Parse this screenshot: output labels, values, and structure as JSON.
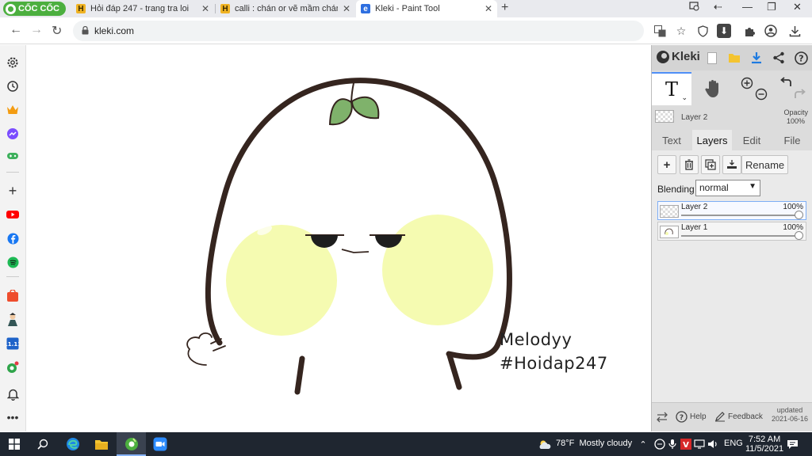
{
  "browser": {
    "brand": "CỐC CỐC",
    "tabs": [
      {
        "title": "Hỏi đáp 247 - trang tra loi",
        "active": false
      },
      {
        "title": "calli : chán or vẽ mầm chán N",
        "active": false
      },
      {
        "title": "Kleki - Paint Tool",
        "active": true
      }
    ],
    "url": "kleki.com"
  },
  "canvas": {
    "signature_line1": "Melodyy",
    "signature_line2": "#Hoidap247"
  },
  "kleki": {
    "app_name": "Kleki",
    "current_layer": {
      "name": "Layer 2",
      "opacity_label": "Opacity",
      "opacity_value": "100%"
    },
    "tabs": [
      "Text",
      "Layers",
      "Edit",
      "File"
    ],
    "active_tab": "Layers",
    "rename_label": "Rename",
    "blending_label": "Blending",
    "blending_value": "normal",
    "layers": [
      {
        "name": "Layer 2",
        "opacity": "100%",
        "opacity_fraction": 1.0,
        "selected": true
      },
      {
        "name": "Layer 1",
        "opacity": "100%",
        "opacity_fraction": 1.0,
        "selected": false
      }
    ],
    "footer": {
      "help": "Help",
      "feedback": "Feedback",
      "updated_label": "updated",
      "updated_date": "2021-06-16"
    }
  },
  "taskbar": {
    "weather_temp": "78°F",
    "weather_desc": "Mostly cloudy",
    "language": "ENG",
    "time": "7:52 AM",
    "date": "11/5/2021"
  },
  "colors": {
    "accent_blue": "#4f8ff7",
    "taskbar_bg": "#1f2630",
    "cheek": "#f5fbb1",
    "leaf": "#7fb26b",
    "outline": "#35251f"
  }
}
